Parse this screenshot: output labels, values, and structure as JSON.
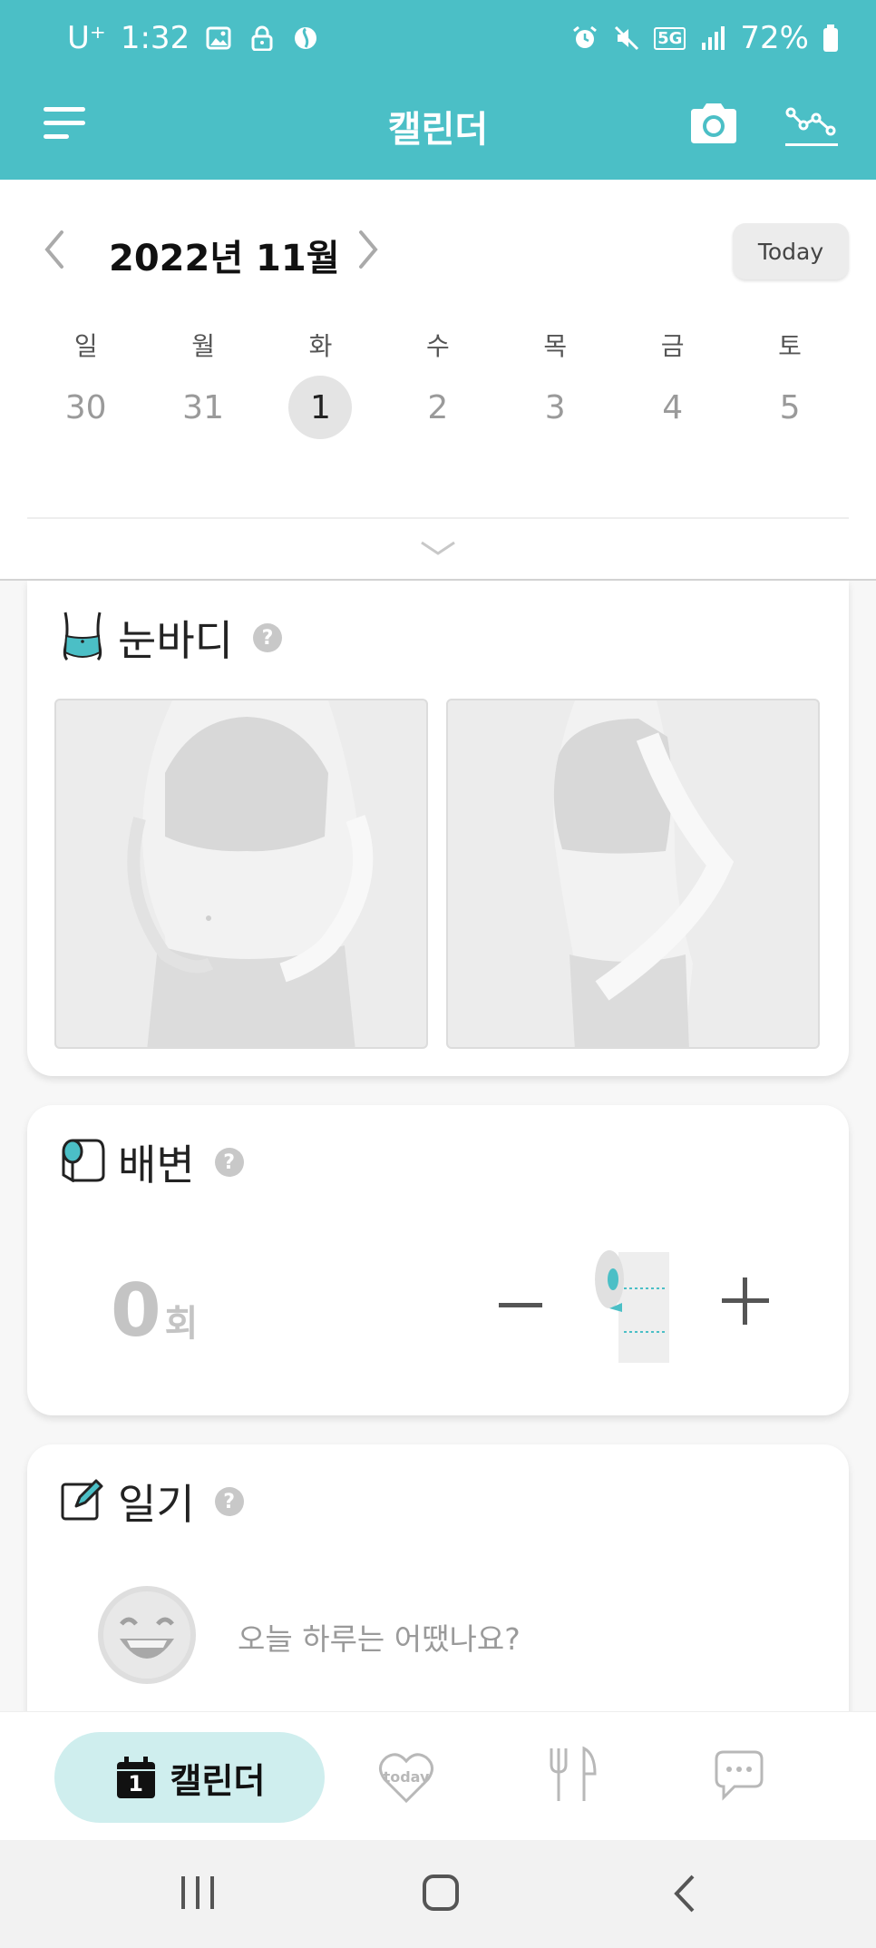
{
  "status_bar": {
    "carrier": "U⁺",
    "time": "1:32",
    "battery": "72%",
    "network": "5G",
    "icons": [
      "image-icon",
      "lock-icon",
      "app-icon",
      "alarm-icon",
      "mute-icon",
      "signal-icon",
      "battery-icon"
    ]
  },
  "header": {
    "title": "캘린더",
    "icons": [
      "menu-icon",
      "camera-icon",
      "graph-icon"
    ],
    "color": "#4bbfc6"
  },
  "calendar": {
    "month_label": "2022년 11월",
    "today_label": "Today",
    "weekdays": [
      "일",
      "월",
      "화",
      "수",
      "목",
      "금",
      "토"
    ],
    "dates": [
      "30",
      "31",
      "1",
      "2",
      "3",
      "4",
      "5"
    ],
    "selected_date": "1"
  },
  "body_card": {
    "title": "눈바디",
    "help": "?",
    "photos": [
      "front-body-placeholder",
      "side-body-placeholder"
    ]
  },
  "bowel_card": {
    "title": "배변",
    "help": "?",
    "count": "0",
    "unit": "회"
  },
  "diary_card": {
    "title": "일기",
    "help": "?",
    "prompt": "오늘 하루는 어땠나요?"
  },
  "tabbar": {
    "active_label": "캘린더",
    "active_icon_date": "1",
    "today_icon_text": "today",
    "tabs": [
      "calendar-tab",
      "today-tab",
      "food-tab",
      "community-tab"
    ]
  }
}
